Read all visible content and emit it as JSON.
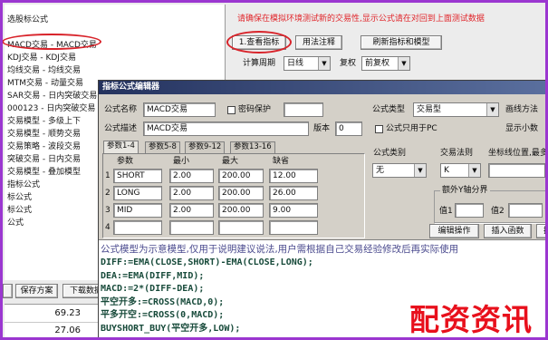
{
  "app": {
    "tree_items": [
      "选股标公式",
      "MACD交易 - MACD交易",
      "KDJ交易 - KDJ交易",
      "均线交易 - 均线交易",
      "MTM交易 - 动量交易",
      "SAR交易 - 日内突破交易",
      "000123 - 日内突破交易",
      "交易模型 - 多级上下",
      "交易模型 - 顺势交易",
      "交易策略 - 波段交易",
      "突破交易 - 日内交易",
      "交易模型 - 叠加模型",
      "指标公式",
      "标公式",
      "标公式",
      "公式"
    ],
    "selected_tree_item": 1,
    "notice": "请确保在模拟环境测试新的交易性,显示公式请在对回到上面测试数据",
    "buttons": {
      "view": "1.查看指标",
      "usage": "用法注释",
      "refresh": "刷新指标和模型"
    },
    "period": {
      "label": "计算周期",
      "value": "日线"
    },
    "adjust": {
      "label": "复权",
      "value": "前复权"
    },
    "bottom_buttons": {
      "save": "保存方案",
      "download": "下载数据"
    },
    "bottom_values": [
      "69.23",
      "27.06"
    ],
    "annotation_color": "#d8232a",
    "frame_color": "#9b37d0"
  },
  "editor": {
    "title": "指标公式编辑器",
    "name_label": "公式名称",
    "name_value": "MACD交易",
    "password_label": "密码保护",
    "password_checked": false,
    "type_label": "公式类型",
    "type_value": "交易型",
    "draw_label": "画线方法",
    "desc_label": "公式描述",
    "desc_value": "MACD交易",
    "version_label": "版本",
    "version_value": "0",
    "pc_only_label": "公式只用于PC",
    "pc_only_checked": false,
    "decimal_label": "显示小数",
    "tabs": [
      "参数1-4",
      "参数5-8",
      "参数9-12",
      "参数13-16"
    ],
    "active_tab": 0,
    "param_headers": [
      "参数",
      "最小",
      "最大",
      "缺省"
    ],
    "params": [
      {
        "n": "1",
        "name": "SHORT",
        "min": "2.00",
        "max": "200.00",
        "def": "12.00"
      },
      {
        "n": "2",
        "name": "LONG",
        "min": "2.00",
        "max": "200.00",
        "def": "26.00"
      },
      {
        "n": "3",
        "name": "MID",
        "min": "2.00",
        "max": "200.00",
        "def": "9.00"
      },
      {
        "n": "4",
        "name": "",
        "min": "",
        "max": "",
        "def": ""
      }
    ],
    "category_label": "公式类别",
    "category_value": "无",
    "rule_label": "交易法则",
    "rule_value": "K",
    "axis_label": "坐标线位置,最多6个,用分号分隔",
    "axis_value": "",
    "yaxis_group_label": "额外Y轴分界",
    "v1_label": "值1",
    "v2_label": "值2",
    "action_buttons": {
      "edit": "编辑操作",
      "insert_func": "插入函数",
      "insert_res": "插入资源"
    },
    "note": "公式模型为示意模型,仅用于说明建议说法,用户需根据自己交易经验修改后再实际使用",
    "code_lines": [
      "DIFF:=EMA(CLOSE,SHORT)-EMA(CLOSE,LONG);",
      "DEA:=EMA(DIFF,MID);",
      "MACD:=2*(DIFF-DEA);",
      "平空开多:=CROSS(MACD,0);",
      "平多开空:=CROSS(0,MACD);",
      "BUYSHORT_BUY(平空开多,LOW);"
    ]
  },
  "watermark": "配资资讯"
}
